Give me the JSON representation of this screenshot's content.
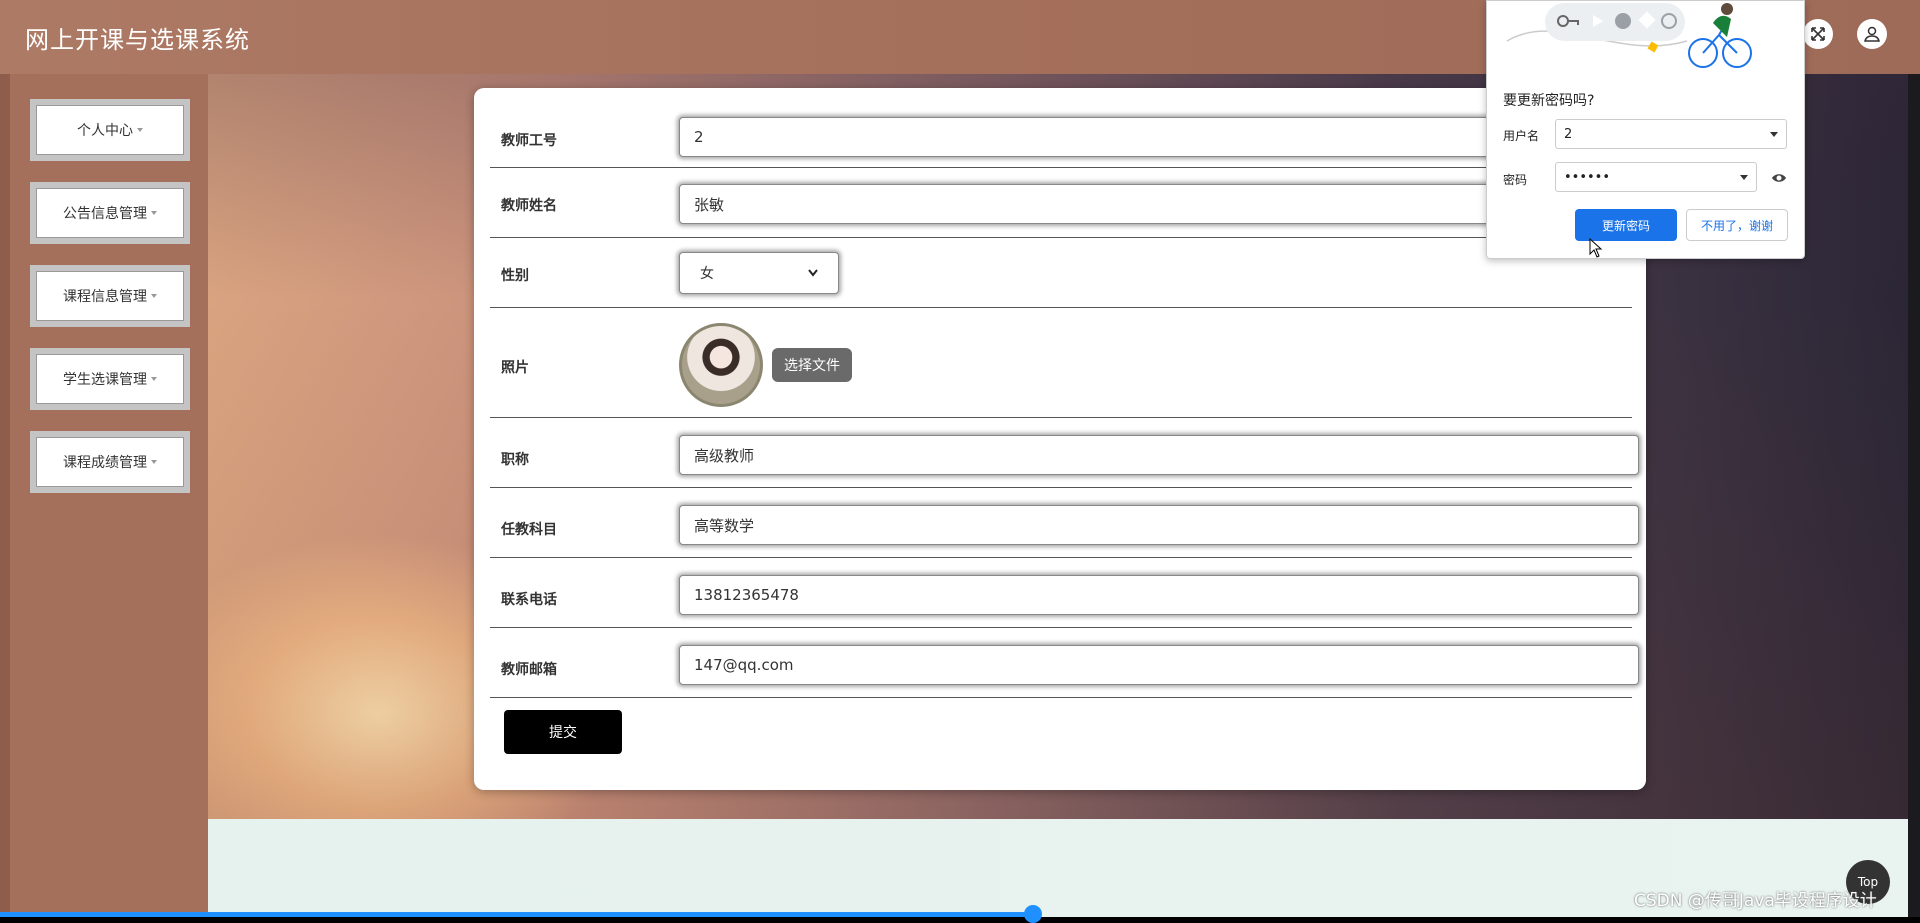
{
  "app": {
    "title": "网上开课与选课系统"
  },
  "sidebar": {
    "items": [
      {
        "label": "个人中心"
      },
      {
        "label": "公告信息管理"
      },
      {
        "label": "课程信息管理"
      },
      {
        "label": "学生选课管理"
      },
      {
        "label": "课程成绩管理"
      }
    ]
  },
  "form": {
    "teacher_id": {
      "label": "教师工号",
      "value": "2"
    },
    "teacher_name": {
      "label": "教师姓名",
      "value": "张敏"
    },
    "gender": {
      "label": "性别",
      "value": "女"
    },
    "photo": {
      "label": "照片",
      "button": "选择文件"
    },
    "title": {
      "label": "职称",
      "value": "高级教师"
    },
    "subject": {
      "label": "任教科目",
      "value": "高等数学"
    },
    "phone": {
      "label": "联系电话",
      "value": "13812365478"
    },
    "email": {
      "label": "教师邮箱",
      "value": "147@qq.com"
    },
    "submit": "提交"
  },
  "password_popup": {
    "question": "要更新密码吗?",
    "username_label": "用户名",
    "username_value": "2",
    "password_label": "密码",
    "password_value": "••••••",
    "update_button": "更新密码",
    "decline_button": "不用了，谢谢"
  },
  "misc": {
    "top_button": "Top",
    "watermark": "CSDN @传哥Java毕设程序设计"
  },
  "colors": {
    "header": "#a46f5b",
    "primary_button": "#1a73e8",
    "submit_button": "#000000"
  }
}
